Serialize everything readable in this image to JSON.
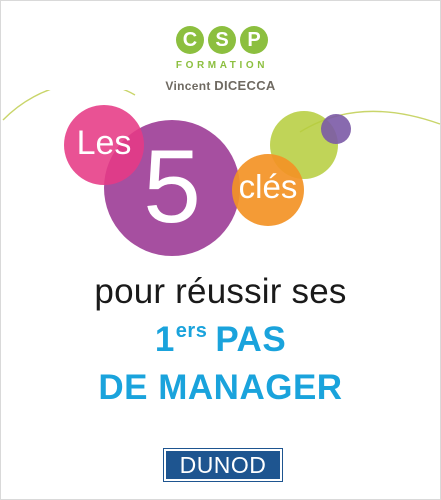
{
  "logo": {
    "letters": [
      "C",
      "S",
      "P"
    ],
    "subtitle": "FORMATION",
    "color": "#8cbf3f"
  },
  "author": {
    "first": "Vincent",
    "last": "DICECCA"
  },
  "title": {
    "les": "Les",
    "five": "5",
    "cles": "clés",
    "line1": "pour réussir ses",
    "line2_main": "1",
    "line2_sup": "ers",
    "line2_rest": "PAS",
    "line3": "DE MANAGER"
  },
  "publisher": "DUNOD",
  "colors": {
    "pink": "#e63a85",
    "purple": "#a64fa0",
    "orange": "#f39225",
    "green": "#b5cc3b",
    "violet": "#7b5aa6",
    "blue": "#1aa3dc",
    "navy": "#1e5590"
  }
}
